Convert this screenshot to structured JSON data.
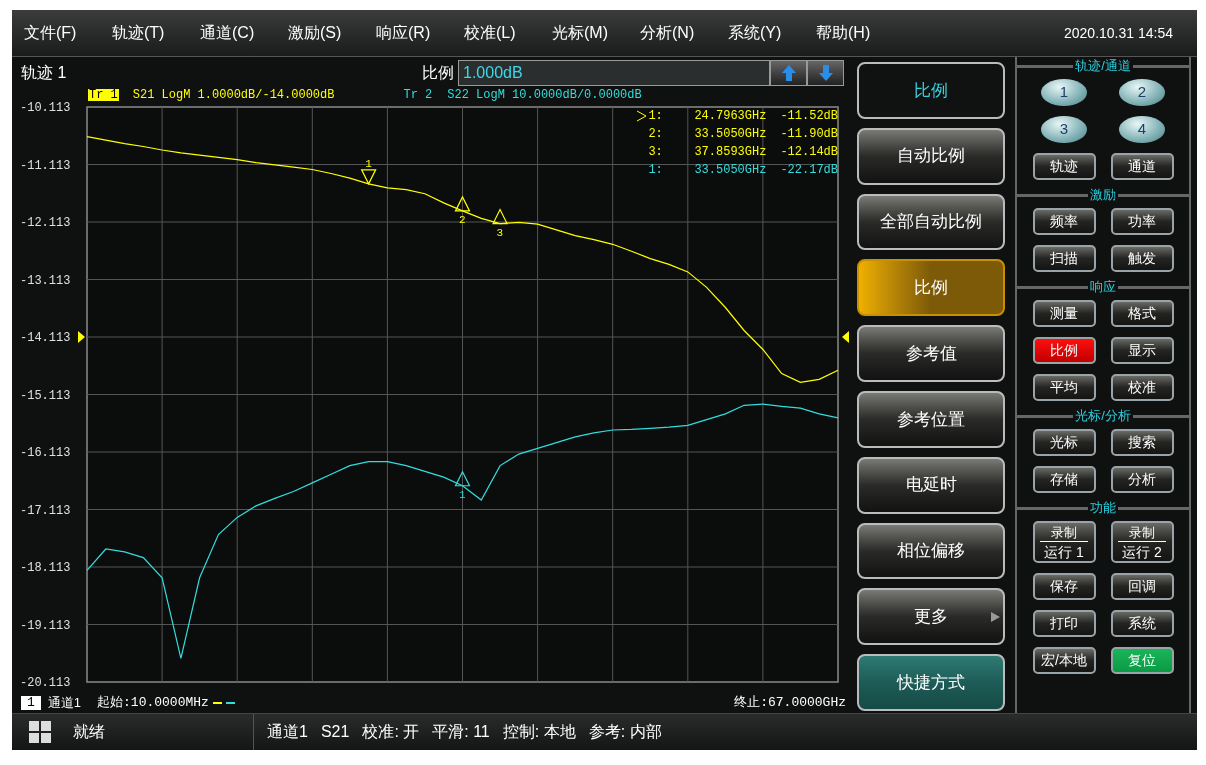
{
  "menu": [
    "文件(F)",
    "轨迹(T)",
    "通道(C)",
    "激励(S)",
    "响应(R)",
    "校准(L)",
    "光标(M)",
    "分析(N)",
    "系统(Y)",
    "帮助(H)"
  ],
  "datetime": "2020.10.31 14:54",
  "trace_panel": {
    "title": "轨迹 1",
    "entry_label": "比例",
    "entry_value": "1.000dB",
    "traces": [
      {
        "info": "S21 LogM 1.0000dB/-14.0000dB",
        "color": "#ffff00",
        "selected": true
      },
      {
        "info": "S22 LogM 10.0000dB/0.0000dB",
        "color": "#33dddd",
        "selected": false
      }
    ],
    "marker_readout": [
      {
        "label": "1:",
        "freq": "24.7963GHz",
        "value": "-11.52dB",
        "color": "#ffff00",
        "selected": true
      },
      {
        "label": "2:",
        "freq": "33.5050GHz",
        "value": "-11.90dB",
        "color": "#ffff00",
        "selected": false
      },
      {
        "label": "3:",
        "freq": "37.8593GHz",
        "value": "-12.14dB",
        "color": "#ffff00",
        "selected": false
      },
      {
        "label": "1:",
        "freq": "33.5050GHz",
        "value": "-22.17dB",
        "color": "#33dddd",
        "selected": false
      }
    ],
    "markers": [
      {
        "label": "1",
        "color": "#ffff00"
      },
      {
        "label": "2",
        "color": "#ffff00"
      },
      {
        "label": "3",
        "color": "#ffff00"
      },
      {
        "label": "1",
        "color": "#33dddd"
      }
    ],
    "chart_data": {
      "type": "line",
      "grid": true,
      "categories": [
        null,
        null,
        null,
        null,
        null,
        null,
        null,
        null,
        null,
        null,
        null,
        null,
        null,
        null,
        null,
        null,
        null,
        null,
        null,
        null,
        null,
        null,
        null,
        null,
        null,
        null,
        null,
        null,
        null,
        null,
        null,
        null,
        null,
        null,
        null,
        null,
        null,
        null,
        null,
        null,
        null
      ],
      "ylim": [
        -20.113,
        -10.113
      ],
      "yticks": [
        {
          "value": -10.113,
          "label": "-10.113"
        },
        {
          "value": -11.113,
          "label": "-11.113"
        },
        {
          "value": -12.113,
          "label": "-12.113"
        },
        {
          "value": -13.113,
          "label": "-13.113"
        },
        {
          "value": -14.113,
          "label": "-14.113"
        },
        {
          "value": -15.113,
          "label": "-15.113"
        },
        {
          "value": -16.113,
          "label": "-16.113"
        },
        {
          "value": -17.113,
          "label": "-17.113"
        },
        {
          "value": -18.113,
          "label": "-18.113"
        },
        {
          "value": -19.113,
          "label": "-19.113"
        },
        {
          "value": -20.113,
          "label": "-20.113"
        }
      ],
      "series": [
        {
          "name": "Tr 1",
          "color": "#ffff00",
          "values": [
            -10.63,
            -10.69,
            -10.75,
            -10.8,
            -10.86,
            -10.91,
            -10.95,
            -10.99,
            -11.03,
            -11.08,
            -11.12,
            -11.16,
            -11.2,
            -11.27,
            -11.35,
            -11.45,
            -11.52,
            -11.55,
            -11.62,
            -11.78,
            -11.92,
            -12.05,
            -12.14,
            -12.12,
            -12.15,
            -12.25,
            -12.35,
            -12.42,
            -12.5,
            -12.62,
            -12.75,
            -12.85,
            -12.98,
            -13.25,
            -13.6,
            -14.0,
            -14.33,
            -14.75,
            -14.9,
            -14.85,
            -14.69
          ]
        },
        {
          "name": "Tr 2",
          "color": "#33dddd",
          "values": [
            -18.17,
            -17.8,
            -17.85,
            -17.95,
            -18.3,
            -19.7,
            -18.3,
            -17.55,
            -17.25,
            -17.05,
            -16.92,
            -16.8,
            -16.65,
            -16.5,
            -16.35,
            -16.28,
            -16.28,
            -16.35,
            -16.45,
            -16.55,
            -16.7,
            -16.95,
            -16.35,
            -16.15,
            -16.05,
            -15.95,
            -15.85,
            -15.78,
            -15.73,
            -15.72,
            -15.7,
            -15.68,
            -15.65,
            -15.55,
            -15.45,
            -15.3,
            -15.28,
            -15.32,
            -15.35,
            -15.45,
            -15.52
          ]
        }
      ]
    },
    "channel_number": "1",
    "channel": "通道1",
    "start": "起始:10.0000MHz",
    "stop": "终止:67.0000GHz"
  },
  "softkeys": [
    {
      "label": "比例",
      "kind": "title"
    },
    {
      "label": "自动比例",
      "kind": "normal"
    },
    {
      "label": "全部自动比例",
      "kind": "normal"
    },
    {
      "label": "比例",
      "kind": "selected"
    },
    {
      "label": "参考值",
      "kind": "normal"
    },
    {
      "label": "参考位置",
      "kind": "normal"
    },
    {
      "label": "电延时",
      "kind": "normal"
    },
    {
      "label": "相位偏移",
      "kind": "normal"
    },
    {
      "label": "更多",
      "kind": "more"
    },
    {
      "label": "快捷方式",
      "kind": "shortcut"
    }
  ],
  "groups": [
    {
      "title": "轨迹/通道",
      "buttons": [
        {
          "label": "1",
          "kind": "oval"
        },
        {
          "label": "2",
          "kind": "oval"
        },
        {
          "label": "3",
          "kind": "oval"
        },
        {
          "label": "4",
          "kind": "oval"
        },
        {
          "label": "轨迹",
          "kind": "normal",
          "selected": false
        },
        {
          "label": "通道",
          "kind": "normal",
          "selected": false
        }
      ]
    },
    {
      "title": "激励",
      "buttons": [
        {
          "label": "频率",
          "kind": "normal",
          "selected": false
        },
        {
          "label": "功率",
          "kind": "normal",
          "selected": false
        },
        {
          "label": "扫描",
          "kind": "normal",
          "selected": false
        },
        {
          "label": "触发",
          "kind": "normal",
          "selected": false
        }
      ]
    },
    {
      "title": "响应",
      "buttons": [
        {
          "label": "测量",
          "kind": "normal",
          "selected": false
        },
        {
          "label": "格式",
          "kind": "normal",
          "selected": false
        },
        {
          "label": "比例",
          "kind": "normal",
          "selected": true
        },
        {
          "label": "显示",
          "kind": "normal",
          "selected": false
        },
        {
          "label": "平均",
          "kind": "normal",
          "selected": false
        },
        {
          "label": "校准",
          "kind": "normal",
          "selected": false
        }
      ]
    },
    {
      "title": "光标/分析",
      "buttons": [
        {
          "label": "光标",
          "kind": "normal",
          "selected": false
        },
        {
          "label": "搜索",
          "kind": "normal",
          "selected": false
        },
        {
          "label": "存储",
          "kind": "normal",
          "selected": false
        },
        {
          "label": "分析",
          "kind": "normal",
          "selected": false
        }
      ]
    },
    {
      "title": "功能",
      "buttons": [
        {
          "label": "录制",
          "sub": "运行 1",
          "kind": "split"
        },
        {
          "label": "录制",
          "sub": "运行 2",
          "kind": "split"
        },
        {
          "label": "保存",
          "kind": "normal",
          "selected": false
        },
        {
          "label": "回调",
          "kind": "normal",
          "selected": false
        },
        {
          "label": "打印",
          "kind": "normal",
          "selected": false
        },
        {
          "label": "系统",
          "kind": "normal",
          "selected": false
        },
        {
          "label": "宏/本地",
          "kind": "normal",
          "selected": false
        },
        {
          "label": "复位",
          "kind": "accent",
          "selected": false
        }
      ]
    }
  ],
  "status_bar": {
    "state": "就绪",
    "items": [
      "通道1",
      "S21",
      "校准: 开",
      "平滑: 11",
      "控制: 本地",
      "参考: 内部"
    ]
  }
}
